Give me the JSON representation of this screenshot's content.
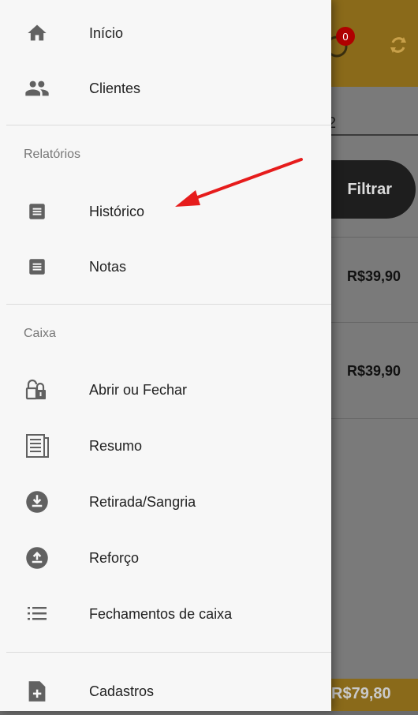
{
  "background": {
    "notification_count": "0",
    "filter_label": "Filtrar",
    "field_fragment": "2",
    "prices": [
      "R$39,90",
      "R$39,90"
    ],
    "total": "R$79,80"
  },
  "drawer": {
    "top_items": [
      {
        "label": "Início",
        "icon": "home-icon"
      },
      {
        "label": "Clientes",
        "icon": "people-icon"
      }
    ],
    "reports_section": "Relatórios",
    "reports_items": [
      {
        "label": "Histórico",
        "icon": "list-icon"
      },
      {
        "label": "Notas",
        "icon": "list-icon"
      }
    ],
    "cash_section": "Caixa",
    "cash_items": [
      {
        "label": "Abrir ou Fechar",
        "icon": "lock-open-icon"
      },
      {
        "label": "Resumo",
        "icon": "receipt-icon"
      },
      {
        "label": "Retirada/Sangria",
        "icon": "download-circle-icon"
      },
      {
        "label": "Reforço",
        "icon": "upload-circle-icon"
      },
      {
        "label": "Fechamentos de caixa",
        "icon": "list-bullets-icon"
      }
    ],
    "bottom_items": [
      {
        "label": "Cadastros",
        "icon": "add-file-icon"
      }
    ]
  },
  "colors": {
    "accent": "#e0a520",
    "arrow": "#e61c1c"
  }
}
